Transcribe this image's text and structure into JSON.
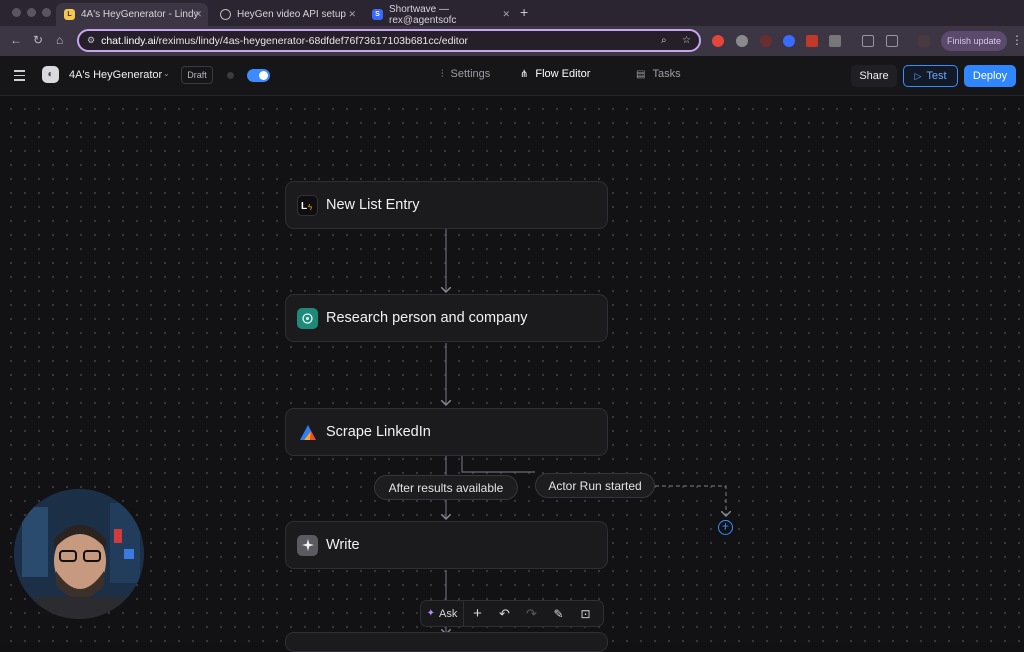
{
  "browser": {
    "tabs": [
      {
        "title": "4A's HeyGenerator - Lindy",
        "active": true
      },
      {
        "title": "HeyGen video API setup",
        "active": false
      },
      {
        "title": "Shortwave — rex@agentsofc",
        "active": false
      }
    ],
    "url_prefix": "chat.lindy.ai",
    "url_rest": "/reximus/lindy/4as-heygenerator-68dfdef76f73617103b681cc/editor",
    "finish_update": "Finish update"
  },
  "app": {
    "name": "4A's HeyGenerator",
    "status": "Draft",
    "nav": [
      "Settings",
      "Flow Editor",
      "Tasks"
    ],
    "active_nav": "Flow Editor",
    "share": "Share",
    "test": "Test",
    "deploy": "Deploy",
    "accent": "#2f86ff"
  },
  "flow": {
    "nodes": [
      {
        "label": "New List Entry",
        "icon": "lindy-trigger-icon"
      },
      {
        "label": "Research person and company",
        "icon": "research-agent-icon"
      },
      {
        "label": "Scrape LinkedIn",
        "icon": "apify-icon"
      },
      {
        "label": "Write",
        "icon": "ai-sparkle-icon"
      }
    ],
    "branches": [
      "After results available",
      "Actor Run started"
    ]
  },
  "toolbar": {
    "ask": "Ask",
    "icons": [
      "add-icon",
      "undo-icon",
      "redo-icon",
      "auto-layout-icon",
      "fit-view-icon"
    ]
  }
}
